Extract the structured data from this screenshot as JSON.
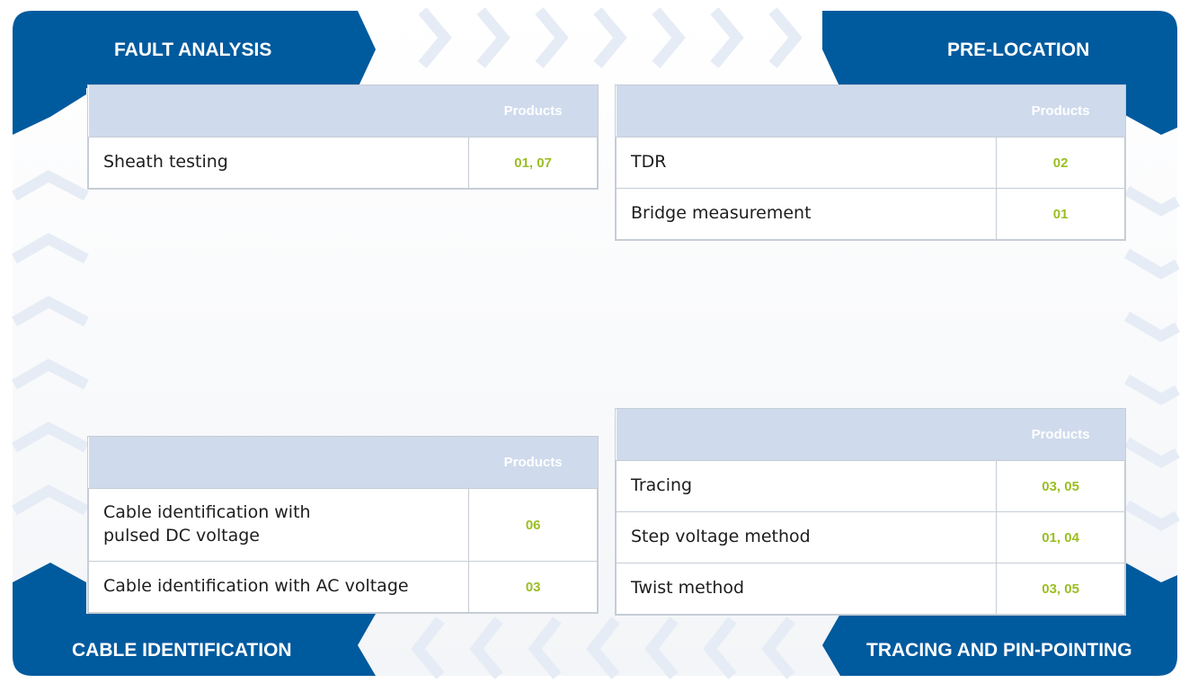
{
  "colors": {
    "brand_blue": "#005a9e",
    "header_fill": "#cfdaec",
    "value_green": "#9bbe24",
    "chevron": "#e6ecf5"
  },
  "banners": {
    "top_left": "FAULT ANALYSIS",
    "top_right": "PRE-LOCATION",
    "bottom_left": "CABLE IDENTIFICATION",
    "bottom_right": "TRACING AND PIN-POINTING"
  },
  "fault_analysis": {
    "header": "Products",
    "rows": [
      {
        "label": "Sheath testing",
        "products": "01, 07"
      }
    ]
  },
  "pre_location": {
    "header": "Products",
    "rows": [
      {
        "label": "TDR",
        "products": "02"
      },
      {
        "label": "Bridge measurement",
        "products": "01"
      }
    ]
  },
  "cable_identification": {
    "header": "Products",
    "rows": [
      {
        "label": "Cable identification with pulsed DC voltage",
        "products": "06"
      },
      {
        "label": "Cable identification with AC voltage",
        "products": "03"
      }
    ]
  },
  "tracing": {
    "header": "Products",
    "rows": [
      {
        "label": "Tracing",
        "products": "03, 05"
      },
      {
        "label": "Step voltage method",
        "products": "01, 04"
      },
      {
        "label": "Twist method",
        "products": "03, 05"
      }
    ]
  }
}
